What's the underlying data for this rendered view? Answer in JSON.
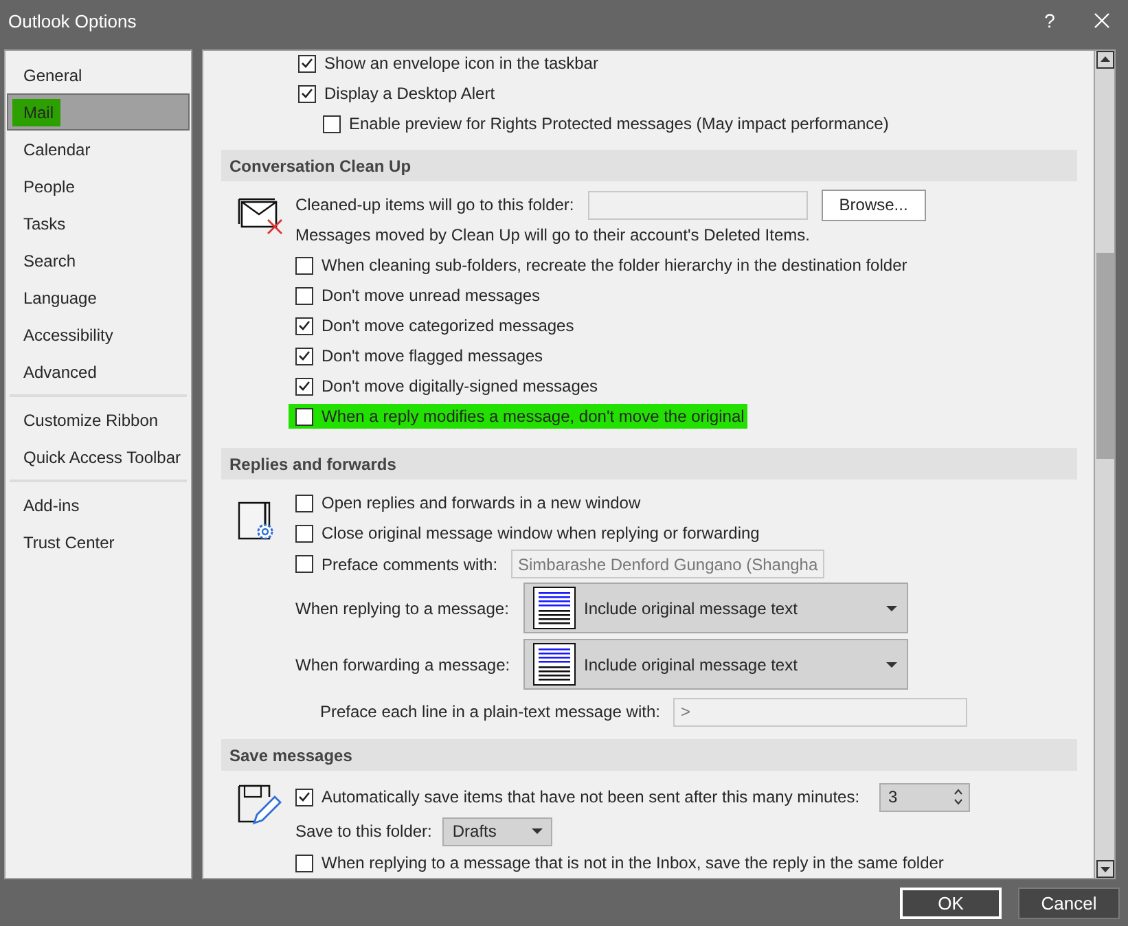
{
  "window": {
    "title": "Outlook Options",
    "help": "?"
  },
  "sidebar": {
    "groups": [
      [
        {
          "label": "General",
          "selected": false,
          "highlighted": false
        },
        {
          "label": "Mail",
          "selected": true,
          "highlighted": true
        },
        {
          "label": "Calendar",
          "selected": false,
          "highlighted": false
        },
        {
          "label": "People",
          "selected": false,
          "highlighted": false
        },
        {
          "label": "Tasks",
          "selected": false,
          "highlighted": false
        },
        {
          "label": "Search",
          "selected": false,
          "highlighted": false
        },
        {
          "label": "Language",
          "selected": false,
          "highlighted": false
        },
        {
          "label": "Accessibility",
          "selected": false,
          "highlighted": false
        },
        {
          "label": "Advanced",
          "selected": false,
          "highlighted": false
        }
      ],
      [
        {
          "label": "Customize Ribbon",
          "selected": false,
          "highlighted": false
        },
        {
          "label": "Quick Access Toolbar",
          "selected": false,
          "highlighted": false
        }
      ],
      [
        {
          "label": "Add-ins",
          "selected": false,
          "highlighted": false
        },
        {
          "label": "Trust Center",
          "selected": false,
          "highlighted": false
        }
      ]
    ]
  },
  "top_options": [
    {
      "label": "Show an envelope icon in the taskbar",
      "checked": true
    },
    {
      "label": "Display a Desktop Alert",
      "checked": true,
      "children": [
        {
          "label": "Enable preview for Rights Protected messages (May impact performance)",
          "checked": false
        }
      ]
    }
  ],
  "cleanup": {
    "title": "Conversation Clean Up",
    "folder_label": "Cleaned-up items will go to this folder:",
    "browse": "Browse...",
    "note": "Messages moved by Clean Up will go to their account's Deleted Items.",
    "options": [
      {
        "label": "When cleaning sub-folders, recreate the folder hierarchy in the destination folder",
        "checked": false,
        "highlighted": false
      },
      {
        "label": "Don't move unread messages",
        "checked": false,
        "highlighted": false
      },
      {
        "label": "Don't move categorized messages",
        "checked": true,
        "highlighted": false
      },
      {
        "label": "Don't move flagged messages",
        "checked": true,
        "highlighted": false
      },
      {
        "label": "Don't move digitally-signed messages",
        "checked": true,
        "highlighted": false
      },
      {
        "label": "When a reply modifies a message, don't move the original",
        "checked": false,
        "highlighted": true
      }
    ]
  },
  "replies": {
    "title": "Replies and forwards",
    "options": [
      {
        "label": "Open replies and forwards in a new window",
        "checked": false
      },
      {
        "label": "Close original message window when replying or forwarding",
        "checked": false
      }
    ],
    "preface": {
      "label": "Preface comments with:",
      "checked": false,
      "value": "Simbarashe Denford Gungano (Shangha"
    },
    "dropdowns": [
      {
        "label": "When replying to a message:",
        "value": "Include original message text"
      },
      {
        "label": "When forwarding a message:",
        "value": "Include original message text"
      }
    ],
    "prefix": {
      "label": "Preface each line in a plain-text message with:",
      "value": ">"
    }
  },
  "save": {
    "title": "Save messages",
    "autosave": {
      "label": "Automatically save items that have not been sent after this many minutes:",
      "checked": true,
      "value": "3"
    },
    "folder": {
      "label": "Save to this folder:",
      "value": "Drafts"
    },
    "same_folder": {
      "label": "When replying to a message that is not in the Inbox, save the reply in the same folder",
      "checked": false
    }
  },
  "buttons": [
    {
      "label": "OK",
      "default": true
    },
    {
      "label": "Cancel",
      "default": false
    }
  ]
}
